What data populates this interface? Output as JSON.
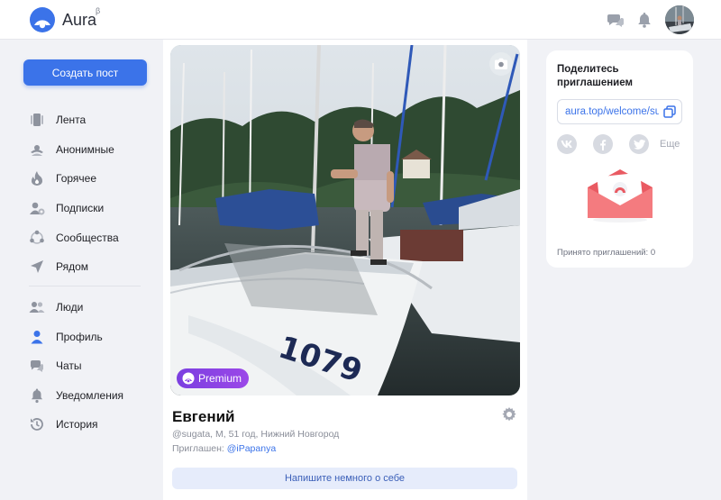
{
  "header": {
    "brand": "Aura",
    "brand_sup": "β",
    "icons": [
      "aura-logo-icon",
      "chat-icon",
      "bell-icon"
    ]
  },
  "sidebar": {
    "create_post_label": "Создать пост",
    "items": [
      {
        "label": "Лента",
        "icon": "feed-icon"
      },
      {
        "label": "Анонимные",
        "icon": "anonymous-icon"
      },
      {
        "label": "Горячее",
        "icon": "fire-icon"
      },
      {
        "label": "Подписки",
        "icon": "subscriptions-icon"
      },
      {
        "label": "Сообщества",
        "icon": "communities-icon"
      },
      {
        "label": "Рядом",
        "icon": "nearby-icon"
      },
      {
        "label": "Люди",
        "icon": "people-icon"
      },
      {
        "label": "Профиль",
        "icon": "profile-icon"
      },
      {
        "label": "Чаты",
        "icon": "chats-icon"
      },
      {
        "label": "Уведомления",
        "icon": "notifications-icon"
      },
      {
        "label": "История",
        "icon": "history-icon"
      }
    ],
    "active_item": "Профиль"
  },
  "profile": {
    "premium_label": "Premium",
    "name": "Евгений",
    "meta": "@sugata, М, 51 год, Нижний Новгород",
    "invited_prefix": "Приглашен: ",
    "invited_by": "@iPapanya",
    "about_button": "Напишите немного о себе",
    "photo_caption_number": "1079"
  },
  "invite": {
    "title": "Поделитесь приглашением",
    "link": "aura.top/welcome/sugata",
    "share_more": "Еще",
    "share_icons": [
      "vk-icon",
      "facebook-icon",
      "twitter-icon"
    ],
    "accepted": "Принято приглашений: 0"
  },
  "colors": {
    "accent": "#3b73e9",
    "premium": "#8a43e6",
    "envelope": "#f06a6e"
  }
}
